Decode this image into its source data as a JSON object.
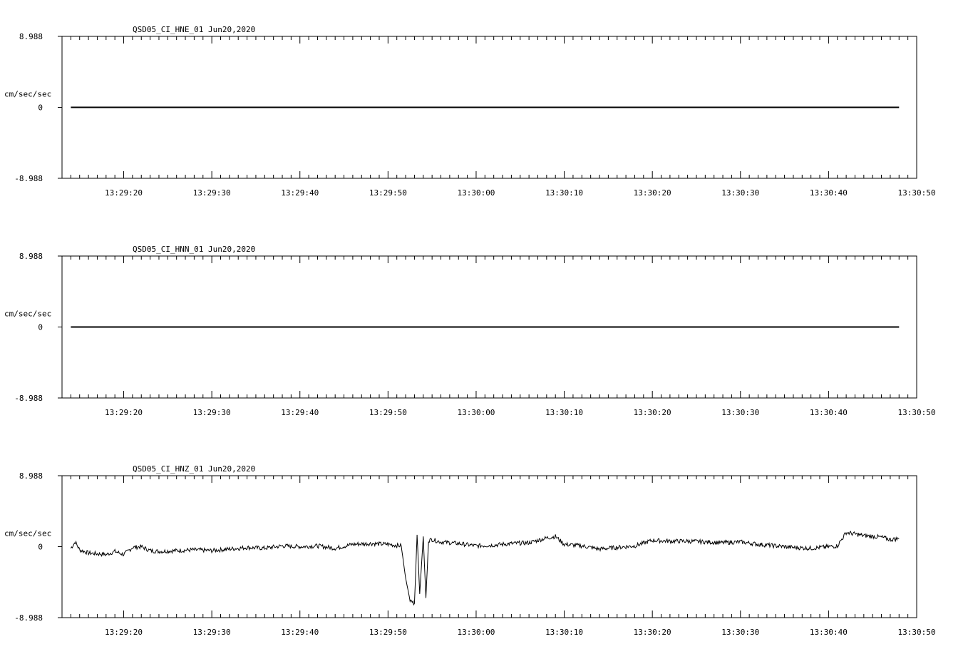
{
  "chart_data": [
    {
      "type": "line",
      "title": "QSD05_CI_HNE_01  Jun20,2020",
      "ylabel": "cm/sec/sec",
      "ylim": [
        -8.988,
        8.988
      ],
      "ytick_labels": [
        "8.988",
        "0",
        "-8.988"
      ],
      "xlim": [
        "13:29:13",
        "13:30:50"
      ],
      "xtick_labels": [
        "13:29:20",
        "13:29:30",
        "13:29:40",
        "13:29:50",
        "13:30:00",
        "13:30:10",
        "13:30:20",
        "13:30:30",
        "13:30:40",
        "13:30:50"
      ],
      "grid": false,
      "series": [
        {
          "x": [
            "13:29:14",
            "13:30:48"
          ],
          "values": [
            0.0,
            0.0
          ],
          "color": "#000000"
        }
      ]
    },
    {
      "type": "line",
      "title": "QSD05_CI_HNN_01  Jun20,2020",
      "ylabel": "cm/sec/sec",
      "ylim": [
        -8.988,
        8.988
      ],
      "ytick_labels": [
        "8.988",
        "0",
        "-8.988"
      ],
      "xlim": [
        "13:29:13",
        "13:30:50"
      ],
      "xtick_labels": [
        "13:29:20",
        "13:29:30",
        "13:29:40",
        "13:29:50",
        "13:30:00",
        "13:30:10",
        "13:30:20",
        "13:30:30",
        "13:30:40",
        "13:30:50"
      ],
      "grid": false,
      "series": [
        {
          "x": [
            "13:29:14",
            "13:30:48"
          ],
          "values": [
            0.0,
            0.0
          ],
          "color": "#000000"
        }
      ]
    },
    {
      "type": "line",
      "title": "QSD05_CI_HNZ_01  Jun20,2020",
      "ylabel": "cm/sec/sec",
      "ylim": [
        -8.988,
        8.988
      ],
      "ytick_labels": [
        "8.988",
        "0",
        "-8.988"
      ],
      "xlim": [
        "13:29:13",
        "13:30:50"
      ],
      "xtick_labels": [
        "13:29:20",
        "13:29:30",
        "13:29:40",
        "13:29:50",
        "13:30:00",
        "13:30:10",
        "13:30:20",
        "13:30:30",
        "13:30:40",
        "13:30:50"
      ],
      "grid": false,
      "series": [
        {
          "color": "#000000",
          "x": [
            "13:29:14.0",
            "13:29:14.5",
            "13:29:15.0",
            "13:29:16.0",
            "13:29:17.0",
            "13:29:18.0",
            "13:29:19.0",
            "13:29:20.0",
            "13:29:21.0",
            "13:29:22.0",
            "13:29:23.0",
            "13:29:24.0",
            "13:29:26.0",
            "13:29:28.0",
            "13:29:30.0",
            "13:29:32.0",
            "13:29:34.0",
            "13:29:36.0",
            "13:29:38.0",
            "13:29:40.0",
            "13:29:42.0",
            "13:29:44.0",
            "13:29:46.0",
            "13:29:48.0",
            "13:29:50.0",
            "13:29:51.5",
            "13:29:52.0",
            "13:29:52.5",
            "13:29:53.0",
            "13:29:53.3",
            "13:29:53.6",
            "13:29:54.0",
            "13:29:54.3",
            "13:29:54.6",
            "13:29:55.0",
            "13:29:56.0",
            "13:29:58.0",
            "13:30:00.0",
            "13:30:02.0",
            "13:30:04.0",
            "13:30:06.0",
            "13:30:08.0",
            "13:30:09.0",
            "13:30:10.0",
            "13:30:12.0",
            "13:30:14.0",
            "13:30:16.0",
            "13:30:18.0",
            "13:30:20.0",
            "13:30:22.0",
            "13:30:24.0",
            "13:30:26.0",
            "13:30:28.0",
            "13:30:30.0",
            "13:30:32.0",
            "13:30:34.0",
            "13:30:36.0",
            "13:30:38.0",
            "13:30:40.0",
            "13:30:41.0",
            "13:30:42.0",
            "13:30:43.0",
            "13:30:44.0",
            "13:30:45.0",
            "13:30:46.0",
            "13:30:47.0",
            "13:30:48.0"
          ],
          "values": [
            -0.2,
            0.6,
            -0.4,
            -0.8,
            -0.9,
            -1.0,
            -0.6,
            -1.0,
            -0.1,
            0.0,
            -0.5,
            -0.6,
            -0.5,
            -0.4,
            -0.5,
            -0.3,
            -0.1,
            -0.2,
            0.1,
            0.0,
            0.1,
            -0.2,
            0.3,
            0.4,
            0.3,
            0.1,
            -4.0,
            -6.8,
            -7.2,
            1.5,
            -6.0,
            1.3,
            -6.5,
            0.8,
            0.9,
            0.6,
            0.4,
            0.1,
            0.2,
            0.4,
            0.5,
            1.1,
            1.3,
            0.3,
            0.1,
            -0.3,
            -0.1,
            0.1,
            0.8,
            0.7,
            0.7,
            0.6,
            0.5,
            0.6,
            0.3,
            0.1,
            -0.1,
            -0.2,
            0.0,
            0.1,
            1.8,
            1.6,
            1.4,
            1.3,
            1.2,
            0.9,
            1.0
          ]
        }
      ]
    }
  ]
}
